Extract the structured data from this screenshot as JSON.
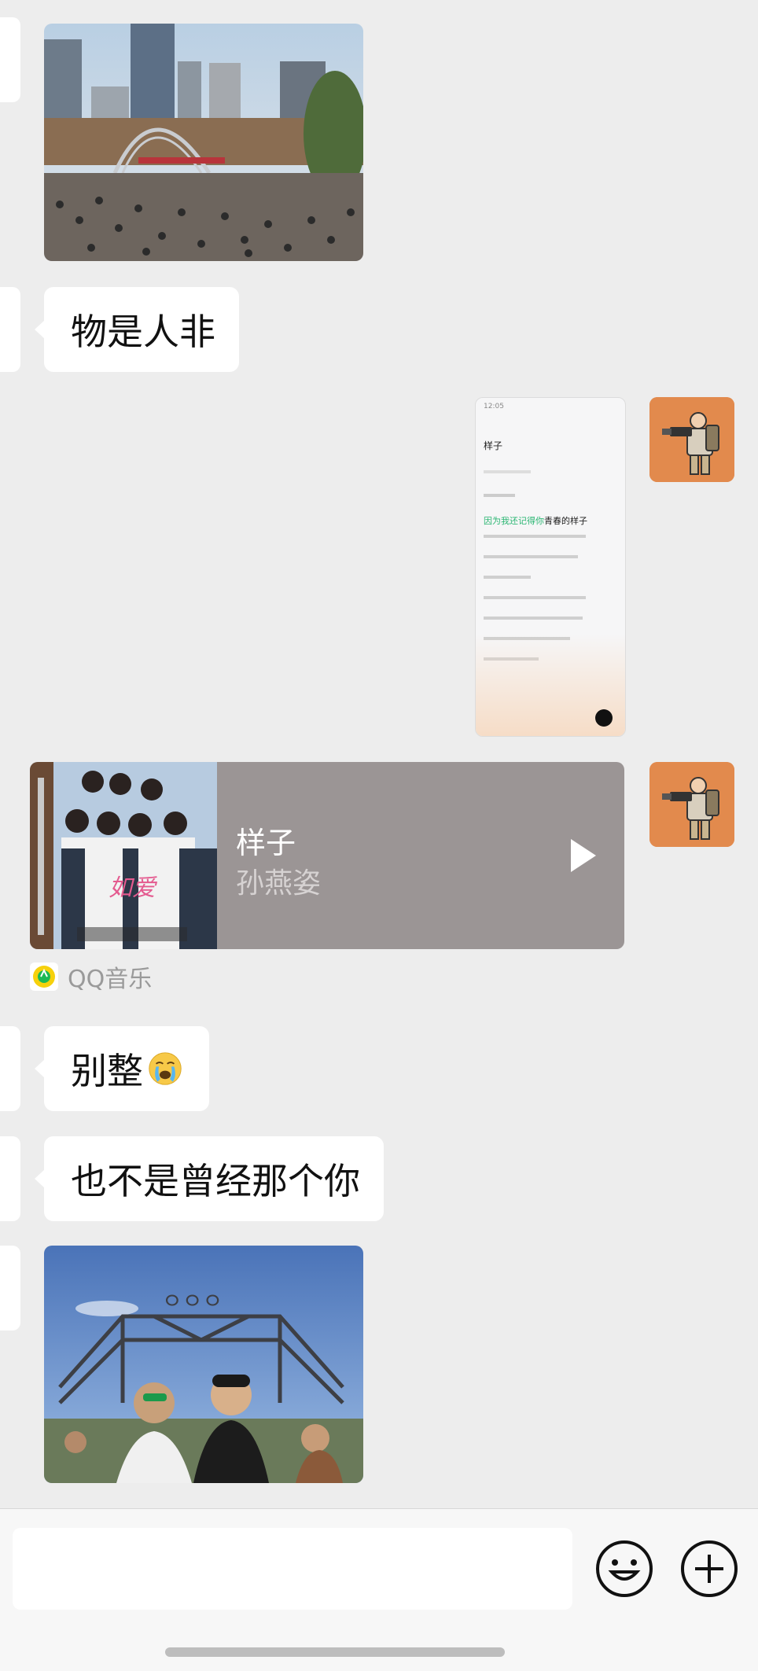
{
  "messages": {
    "text_1": "物是人非",
    "text_2_prefix": "别整",
    "text_2_emoji": "crying-emoji",
    "text_3": "也不是曾经那个你"
  },
  "music_card": {
    "title": "样子",
    "artist": "孙燕姿",
    "play_icon": "play-icon",
    "source_label": "QQ音乐"
  },
  "shared_screenshot": {
    "time": "12:05",
    "song_title": "样子",
    "lyric_highlight_green": "因为我还记得你",
    "lyric_highlight_black": "青春的样子"
  },
  "input_bar": {
    "placeholder": "",
    "emoji_button_icon": "smile-icon",
    "more_button_icon": "plus-circle-icon"
  },
  "colors": {
    "background": "#ededed",
    "bubble": "#ffffff",
    "music_card": "#9b9595",
    "avatar": "#e28a4d"
  }
}
